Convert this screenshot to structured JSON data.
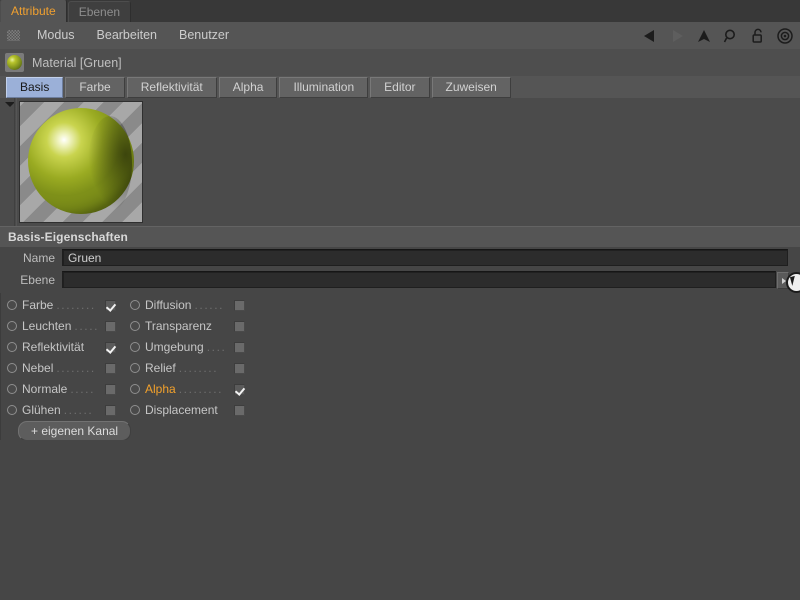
{
  "window_tabs": [
    {
      "label": "Attribute",
      "active": true
    },
    {
      "label": "Ebenen",
      "active": false
    }
  ],
  "menubar": {
    "grip_icon": "drag-grip-icon",
    "items": [
      "Modus",
      "Bearbeiten",
      "Benutzer"
    ],
    "icons": [
      "back-arrow-icon",
      "forward-arrow-icon",
      "up-arrow-icon",
      "search-icon",
      "lock-icon",
      "target-icon"
    ]
  },
  "material": {
    "icon": "material-sphere-icon",
    "title": "Material [Gruen]"
  },
  "channel_tabs": [
    {
      "label": "Basis",
      "active": true
    },
    {
      "label": "Farbe",
      "active": false
    },
    {
      "label": "Reflektivität",
      "active": false
    },
    {
      "label": "Alpha",
      "active": false
    },
    {
      "label": "Illumination",
      "active": false
    },
    {
      "label": "Editor",
      "active": false
    },
    {
      "label": "Zuweisen",
      "active": false
    }
  ],
  "preview": {
    "collapse_icon": "collapse-triangle-icon",
    "swatch_name": "material-preview-sphere"
  },
  "section": {
    "title": "Basis-Eigenschaften"
  },
  "fields": {
    "name_label": "Name",
    "name_value": "Gruen",
    "ebene_label": "Ebene",
    "ebene_value": "",
    "ebene_dropdown_icon": "chevron-right-icon"
  },
  "channels_left": [
    {
      "label": "Farbe",
      "checked": true,
      "selected": false,
      "dots": "........"
    },
    {
      "label": "Leuchten",
      "checked": false,
      "selected": false,
      "dots": "....."
    },
    {
      "label": "Reflektivität",
      "checked": true,
      "selected": false,
      "dots": ""
    },
    {
      "label": "Nebel",
      "checked": false,
      "selected": false,
      "dots": "........"
    },
    {
      "label": "Normale",
      "checked": false,
      "selected": false,
      "dots": "....."
    },
    {
      "label": "Glühen",
      "checked": false,
      "selected": false,
      "dots": "......"
    }
  ],
  "channels_right": [
    {
      "label": "Diffusion",
      "checked": false,
      "selected": false,
      "dots": "......"
    },
    {
      "label": "Transparenz",
      "checked": false,
      "selected": false,
      "dots": ""
    },
    {
      "label": "Umgebung",
      "checked": false,
      "selected": false,
      "dots": "...."
    },
    {
      "label": "Relief",
      "checked": false,
      "selected": false,
      "dots": "........"
    },
    {
      "label": "Alpha",
      "checked": true,
      "selected": true,
      "dots": "........."
    },
    {
      "label": "Displacement",
      "checked": false,
      "selected": false,
      "dots": ""
    }
  ],
  "buttons": {
    "add_channel": "+ eigenen Kanal"
  },
  "colors": {
    "panel_bg": "#464646",
    "bar_bg": "#555555",
    "accent_orange": "#f2a12c",
    "tab_active_blue": "#9bb0d8",
    "material_green": "#8fa01e"
  }
}
